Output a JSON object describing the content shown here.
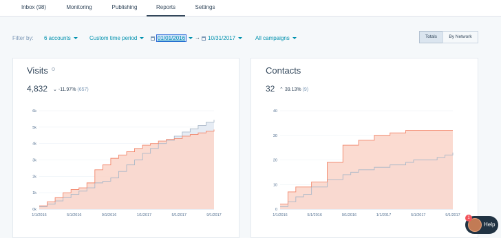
{
  "tabs": [
    {
      "label": "Inbox (98)"
    },
    {
      "label": "Monitoring"
    },
    {
      "label": "Publishing"
    },
    {
      "label": "Reports",
      "active": true
    },
    {
      "label": "Settings"
    }
  ],
  "filters": {
    "label": "Filter by:",
    "accounts": "6 accounts",
    "time_period": "Custom time period",
    "start_date": "01/01/2016",
    "end_date": "10/31/2017",
    "campaigns": "All campaigns",
    "toggle_totals": "Totals",
    "toggle_by_network": "By Network",
    "selected_toggle": "Totals"
  },
  "visits": {
    "title": "Visits",
    "total": "4,832",
    "change": "-11.97%",
    "change_count": "(657)",
    "direction": "down"
  },
  "contacts": {
    "title": "Contacts",
    "total": "32",
    "change": "39.13%",
    "change_count": "(9)",
    "direction": "up"
  },
  "help": {
    "label": "Help",
    "badge": "1"
  },
  "colors": {
    "current_line": "#f2866b",
    "current_fill": "#fbd7cc",
    "compare_line": "#aab8c8",
    "compare_fill": "#e6ecf4",
    "accent": "#0091ae"
  },
  "chart_data": [
    {
      "type": "area",
      "title": "Visits",
      "x_ticks": [
        "1/1/2016",
        "5/1/2016",
        "9/1/2016",
        "1/1/2017",
        "5/1/2017",
        "9/1/2017"
      ],
      "y_ticks": [
        "0k",
        "1k",
        "2k",
        "3k",
        "4k",
        "5k",
        "6k"
      ],
      "ylim": [
        0,
        6000
      ],
      "x_range": [
        0,
        22
      ],
      "series": [
        {
          "role": "current",
          "x": [
            0,
            1,
            2,
            3,
            4,
            5,
            6,
            7,
            8,
            9,
            10,
            11,
            12,
            13,
            14,
            15,
            16,
            17,
            18,
            19,
            20,
            21,
            22
          ],
          "values": [
            200,
            450,
            700,
            1000,
            1200,
            1300,
            1600,
            2400,
            2700,
            3100,
            3300,
            3500,
            3700,
            3900,
            4000,
            4150,
            4250,
            4300,
            4450,
            4550,
            4650,
            4750,
            4850
          ]
        },
        {
          "role": "comparison",
          "x": [
            0,
            1,
            2,
            3,
            4,
            5,
            6,
            7,
            8,
            9,
            10,
            11,
            12,
            13,
            14,
            15,
            16,
            17,
            18,
            19,
            20,
            21,
            22
          ],
          "values": [
            150,
            300,
            500,
            700,
            900,
            1100,
            1300,
            1600,
            1700,
            1900,
            2300,
            2700,
            3000,
            3400,
            3700,
            4000,
            4200,
            4450,
            4700,
            4900,
            5100,
            5300,
            5450
          ]
        }
      ],
      "grid": true
    },
    {
      "type": "area",
      "title": "Contacts",
      "x_ticks": [
        "1/1/2016",
        "5/1/2016",
        "9/1/2016",
        "1/1/2017",
        "5/1/2017",
        "9/1/2017"
      ],
      "y_ticks": [
        "0",
        "10",
        "20",
        "30",
        "40"
      ],
      "ylim": [
        0,
        40
      ],
      "x_range": [
        0,
        22
      ],
      "series": [
        {
          "role": "current",
          "x": [
            0,
            1,
            2,
            3,
            4,
            5,
            6,
            7,
            8,
            9,
            10,
            11,
            12,
            13,
            14,
            15,
            16,
            17,
            18,
            19,
            20,
            21,
            22
          ],
          "values": [
            2,
            7,
            9,
            9,
            11,
            11,
            19,
            19,
            26,
            26,
            28,
            28,
            30,
            30,
            31,
            31,
            32,
            32,
            32,
            32,
            32,
            32,
            32
          ]
        },
        {
          "role": "comparison",
          "x": [
            0,
            1,
            2,
            3,
            4,
            5,
            6,
            7,
            8,
            9,
            10,
            11,
            12,
            13,
            14,
            15,
            16,
            17,
            18,
            19,
            20,
            21,
            22
          ],
          "values": [
            1,
            3,
            5,
            6,
            9,
            9,
            12,
            12,
            14,
            15,
            16,
            16,
            17,
            17,
            18,
            18,
            19,
            20,
            20,
            20,
            21,
            22,
            23
          ]
        }
      ],
      "grid": true
    }
  ]
}
